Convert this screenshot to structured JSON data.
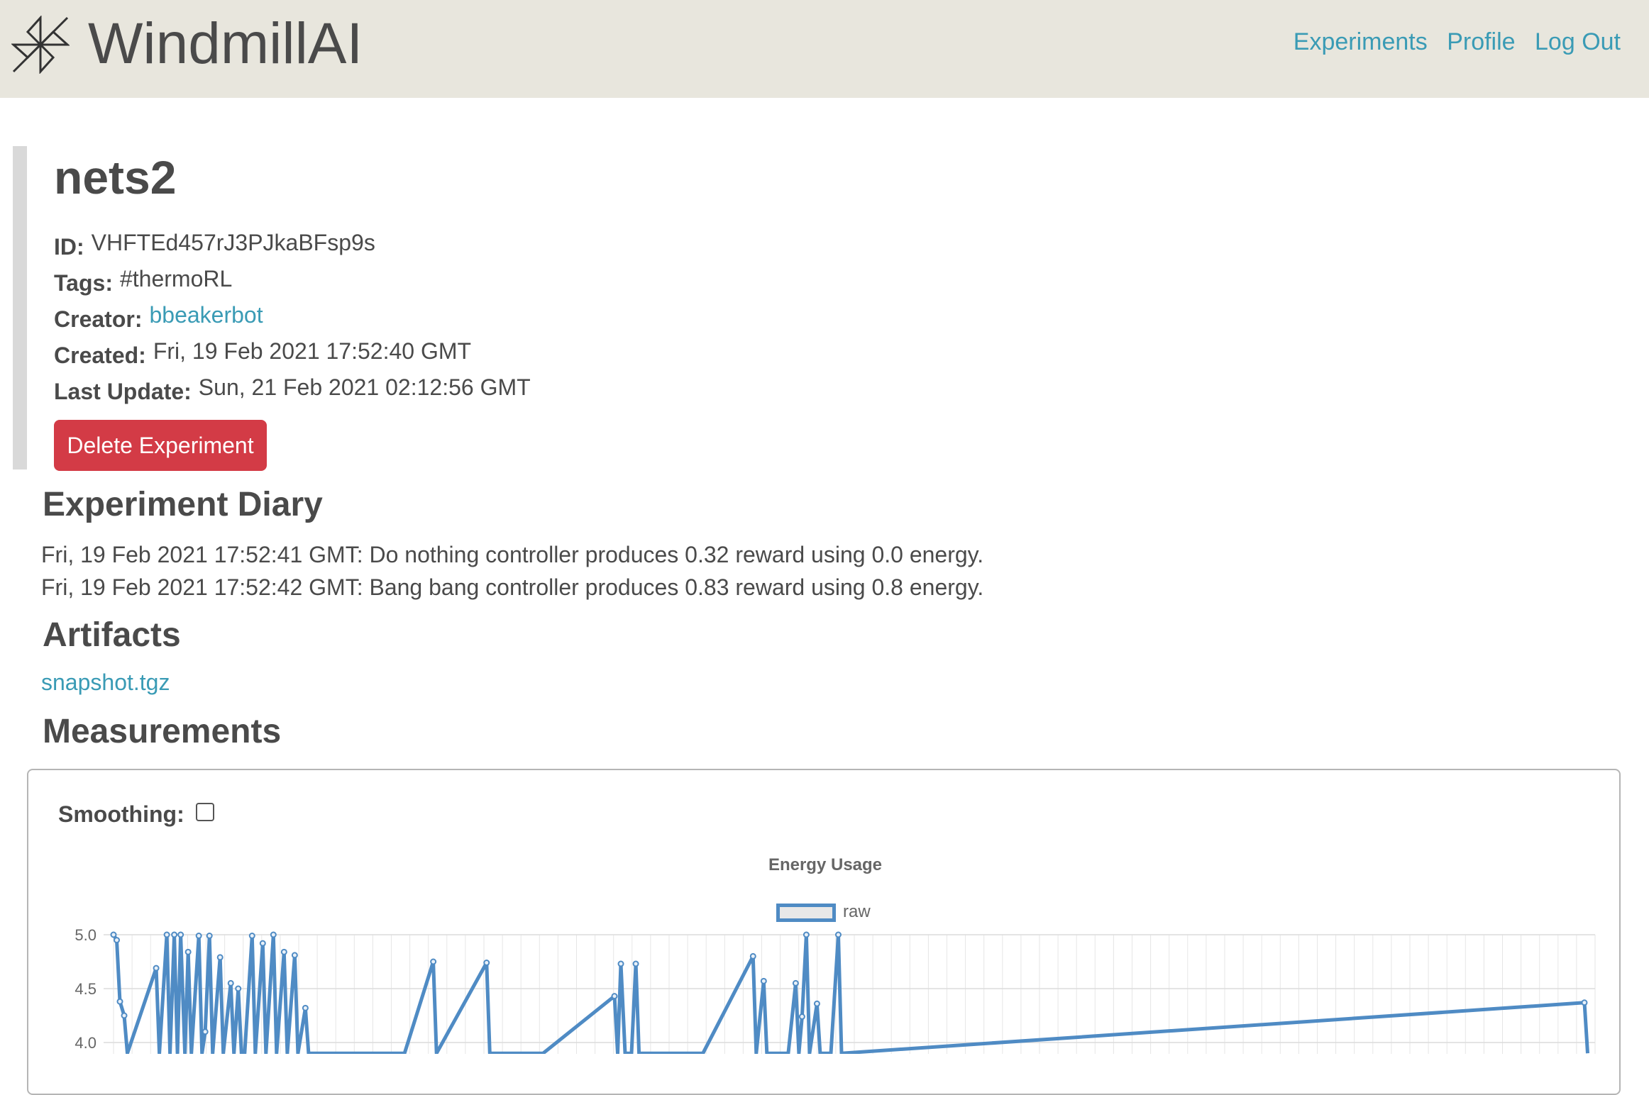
{
  "header": {
    "brand": "WindmillAI",
    "nav": [
      "Experiments",
      "Profile",
      "Log Out"
    ]
  },
  "experiment": {
    "name": "nets2",
    "fields": {
      "id_label": "ID:",
      "id": "VHFTEd457rJ3PJkaBFsp9s",
      "tags_label": "Tags:",
      "tags": "#thermoRL",
      "creator_label": "Creator:",
      "creator": "bbeakerbot",
      "created_label": "Created:",
      "created": "Fri, 19 Feb 2021 17:52:40 GMT",
      "updated_label": "Last Update:",
      "updated": "Sun, 21 Feb 2021 02:12:56 GMT"
    },
    "delete_label": "Delete Experiment"
  },
  "diary": {
    "title": "Experiment Diary",
    "entries": [
      "Fri, 19 Feb 2021 17:52:41 GMT: Do nothing controller produces 0.32 reward using 0.0 energy.",
      "Fri, 19 Feb 2021 17:52:42 GMT: Bang bang controller produces 0.83 reward using 0.8 energy."
    ]
  },
  "artifacts": {
    "title": "Artifacts",
    "files": [
      "snapshot.tgz"
    ]
  },
  "measurements": {
    "title": "Measurements",
    "smoothing_label": "Smoothing:",
    "smoothing_checked": false
  },
  "colors": {
    "accent": "#3a9bb5",
    "danger": "#d33b46",
    "series": "#4f8bc4",
    "header_bg": "#e8e6dd"
  },
  "chart_data": {
    "type": "line",
    "title": "Energy Usage",
    "legend": "top-center",
    "grid": true,
    "y_ticks": [
      "5.0",
      "4.5",
      "4.0"
    ],
    "ylim": [
      3.9,
      5.0
    ],
    "xlim": [
      0,
      139
    ],
    "series": [
      {
        "name": "raw",
        "x": [
          0,
          0.3,
          0.6,
          1,
          1.3,
          4,
          4.3,
          5,
          5.3,
          5.7,
          6,
          6.3,
          6.7,
          7,
          7.3,
          8,
          8.3,
          8.6,
          9,
          9.3,
          10,
          10.3,
          11,
          11.3,
          11.7,
          12,
          12.3,
          13,
          13.3,
          14,
          14.3,
          15,
          15.3,
          16,
          16.3,
          17,
          17.3,
          18,
          18.3,
          19,
          19.3,
          20,
          20.3,
          21,
          21.3,
          22,
          22.3,
          23,
          23.3,
          24,
          24.3,
          25,
          25.3,
          27,
          27.3,
          30,
          30.3,
          35,
          35.3,
          40,
          40.3,
          47,
          47.3,
          47.6,
          48,
          48.3,
          48.6,
          49,
          49.3,
          53,
          53.3,
          55,
          55.3,
          60,
          60.3,
          61,
          61.3,
          61.6,
          62,
          62.3,
          63,
          63.3,
          64,
          64.3,
          64.6,
          65,
          65.3,
          66,
          66.3,
          67,
          67.3,
          68,
          68.3,
          138,
          138.3
        ],
        "y": [
          5.0,
          4.95,
          4.38,
          4.25,
          3.9,
          4.69,
          3.9,
          5.0,
          3.9,
          5.0,
          3.9,
          5.0,
          3.9,
          4.84,
          3.9,
          4.99,
          3.9,
          4.1,
          4.99,
          3.9,
          4.79,
          3.9,
          4.55,
          3.9,
          4.5,
          3.9,
          3.9,
          4.99,
          3.9,
          4.92,
          3.9,
          5.0,
          3.9,
          4.84,
          3.9,
          4.81,
          3.9,
          4.32,
          3.9,
          3.9,
          3.9,
          3.9,
          3.9,
          3.9,
          3.9,
          3.9,
          3.9,
          3.9,
          3.9,
          3.9,
          3.9,
          3.9,
          3.9,
          3.9,
          3.9,
          4.75,
          3.9,
          4.74,
          3.9,
          3.9,
          3.9,
          4.43,
          3.9,
          4.73,
          3.9,
          3.9,
          3.9,
          4.73,
          3.9,
          3.9,
          3.9,
          3.9,
          3.9,
          4.8,
          3.9,
          4.57,
          3.9,
          3.9,
          3.9,
          3.9,
          3.9,
          3.9,
          4.55,
          3.9,
          4.24,
          5.0,
          3.9,
          4.36,
          3.9,
          3.9,
          3.9,
          5.0,
          3.9,
          4.37,
          3.9
        ]
      }
    ]
  }
}
